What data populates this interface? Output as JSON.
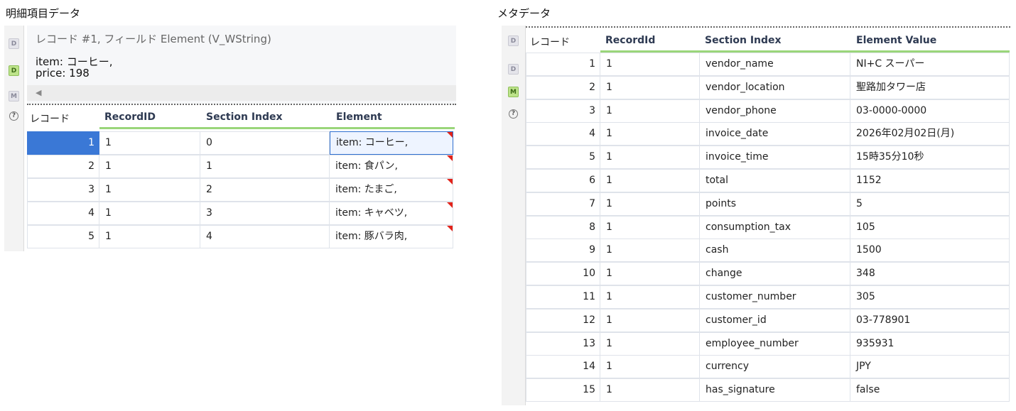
{
  "left": {
    "title": "明細項目データ",
    "description": {
      "header": "レコード #1, フィールド Element (V_WString)",
      "lines": [
        "item: コーヒー,",
        "price: 198"
      ]
    },
    "columns": [
      "レコード",
      "RecordID",
      "Section Index",
      "Element"
    ],
    "rows": [
      {
        "rec": "1",
        "id": "1",
        "idx": "0",
        "val": "item: コーヒー,"
      },
      {
        "rec": "2",
        "id": "1",
        "idx": "1",
        "val": "item: 食パン,"
      },
      {
        "rec": "3",
        "id": "1",
        "idx": "2",
        "val": "item: たまご,"
      },
      {
        "rec": "4",
        "id": "1",
        "idx": "3",
        "val": "item: キャベツ,"
      },
      {
        "rec": "5",
        "id": "1",
        "idx": "4",
        "val": "item: 豚バラ肉,"
      }
    ],
    "side_icons": [
      "D",
      "D",
      "M",
      "?"
    ]
  },
  "right": {
    "title": "メタデータ",
    "columns": [
      "レコード",
      "RecordId",
      "Section Index",
      "Element Value"
    ],
    "rows": [
      {
        "rec": "1",
        "id": "1",
        "idx": "vendor_name",
        "val": "NI+C スーパー"
      },
      {
        "rec": "2",
        "id": "1",
        "idx": "vendor_location",
        "val": "聖路加タワー店"
      },
      {
        "rec": "3",
        "id": "1",
        "idx": "vendor_phone",
        "val": "03-0000-0000"
      },
      {
        "rec": "4",
        "id": "1",
        "idx": "invoice_date",
        "val": "2026年02月02日(月)"
      },
      {
        "rec": "5",
        "id": "1",
        "idx": "invoice_time",
        "val": "15時35分10秒"
      },
      {
        "rec": "6",
        "id": "1",
        "idx": "total",
        "val": "1152"
      },
      {
        "rec": "7",
        "id": "1",
        "idx": "points",
        "val": "5"
      },
      {
        "rec": "8",
        "id": "1",
        "idx": "consumption_tax",
        "val": "105"
      },
      {
        "rec": "9",
        "id": "1",
        "idx": "cash",
        "val": "1500"
      },
      {
        "rec": "10",
        "id": "1",
        "idx": "change",
        "val": "348"
      },
      {
        "rec": "11",
        "id": "1",
        "idx": "customer_number",
        "val": "305"
      },
      {
        "rec": "12",
        "id": "1",
        "idx": "customer_id",
        "val": "03-778901"
      },
      {
        "rec": "13",
        "id": "1",
        "idx": "employee_number",
        "val": "935931"
      },
      {
        "rec": "14",
        "id": "1",
        "idx": "currency",
        "val": "JPY"
      },
      {
        "rec": "15",
        "id": "1",
        "idx": "has_signature",
        "val": "false"
      }
    ],
    "side_icons": [
      "D",
      "D",
      "M",
      "?"
    ]
  },
  "colors": {
    "selection": "#3a78d6",
    "header_underline": "#9ad67a",
    "flag": "#e2231a",
    "active_icon": "#bde38a"
  }
}
